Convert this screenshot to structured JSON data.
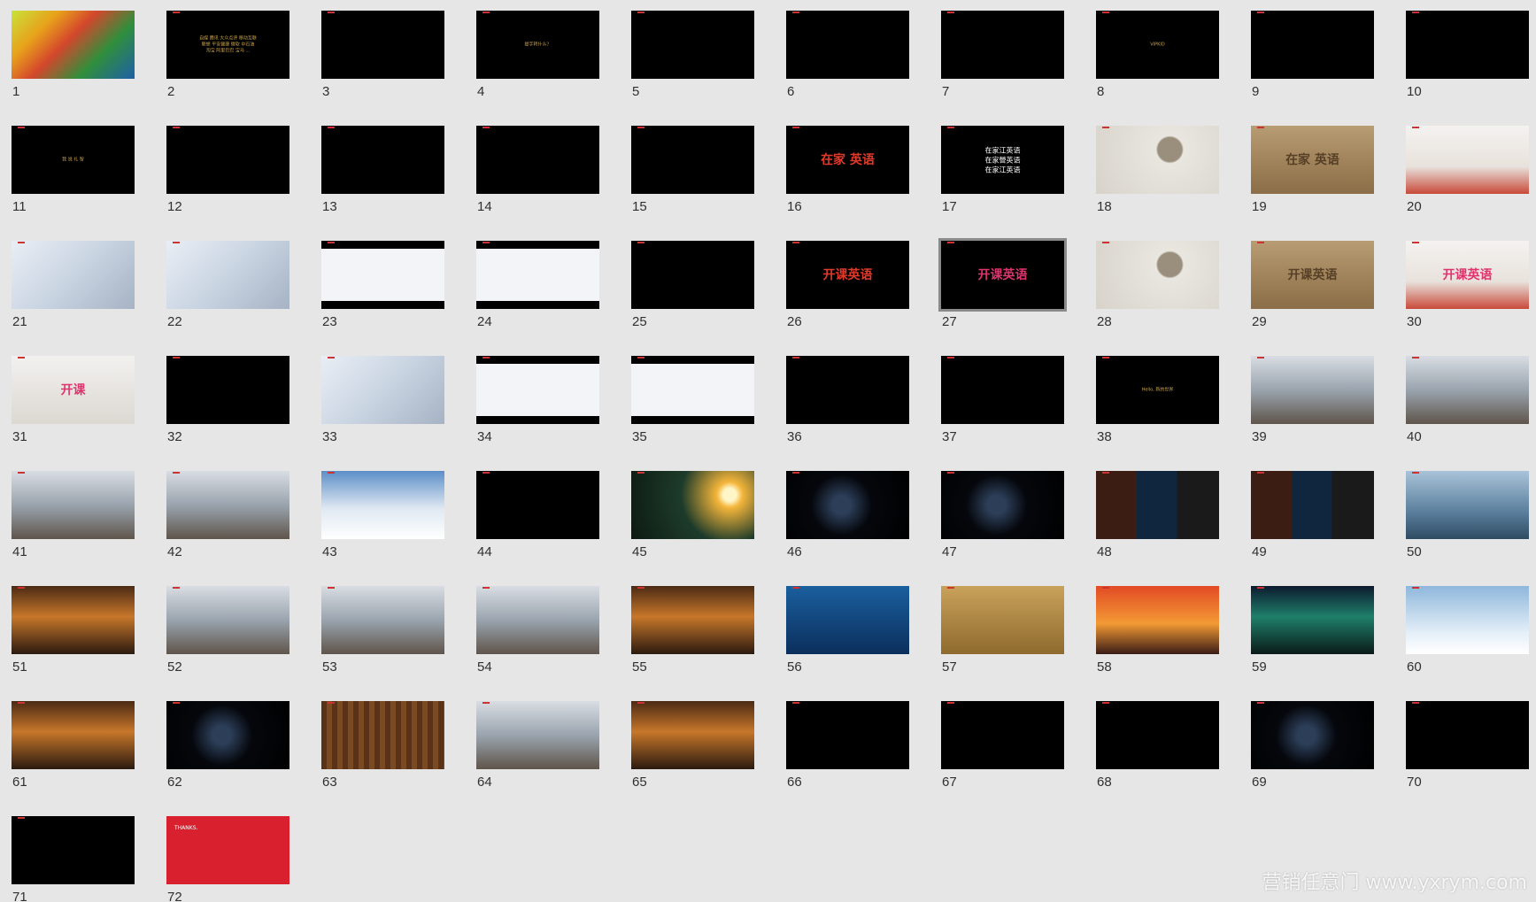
{
  "watermark": "营销任意门 www.yxrym.com",
  "selected_slide": "27",
  "slides": [
    {
      "num": "1",
      "kind": "colorful",
      "cap": ""
    },
    {
      "num": "2",
      "kind": "dark",
      "cap": "自媒  腾讯  大众点评  移动互联\n联想  平安健康  微软  中石油\n淘宝  阿里巴巴  宝马  ..."
    },
    {
      "num": "3",
      "kind": "dark",
      "cap": ""
    },
    {
      "num": "4",
      "kind": "dark",
      "cap": "  提字转什么？"
    },
    {
      "num": "5",
      "kind": "dark",
      "cap": ""
    },
    {
      "num": "6",
      "kind": "dark",
      "cap": ""
    },
    {
      "num": "7",
      "kind": "dark",
      "cap": ""
    },
    {
      "num": "8",
      "kind": "dark",
      "cap": "VIPKID"
    },
    {
      "num": "9",
      "kind": "dark",
      "cap": ""
    },
    {
      "num": "10",
      "kind": "dark",
      "cap": ""
    },
    {
      "num": "11",
      "kind": "dark",
      "cap": "我 说 礼 智"
    },
    {
      "num": "12",
      "kind": "dark",
      "cap": ""
    },
    {
      "num": "13",
      "kind": "dark",
      "cap": ""
    },
    {
      "num": "14",
      "kind": "dark",
      "cap": ""
    },
    {
      "num": "15",
      "kind": "dark",
      "cap": ""
    },
    {
      "num": "16",
      "kind": "dark",
      "cap": "在家 英语",
      "style": "big-red"
    },
    {
      "num": "17",
      "kind": "dark",
      "cap": "在家江英语\n在家營英语\n在家江英语",
      "style": "stack"
    },
    {
      "num": "18",
      "kind": "paper",
      "cap": ""
    },
    {
      "num": "19",
      "kind": "wood",
      "cap": "在家  英语",
      "style": "engrave"
    },
    {
      "num": "20",
      "kind": "office",
      "cap": ""
    },
    {
      "num": "21",
      "kind": "mock",
      "cap": ""
    },
    {
      "num": "22",
      "kind": "mock",
      "cap": ""
    },
    {
      "num": "23",
      "kind": "web",
      "cap": ""
    },
    {
      "num": "24",
      "kind": "web",
      "cap": ""
    },
    {
      "num": "25",
      "kind": "dark",
      "cap": ""
    },
    {
      "num": "26",
      "kind": "dark",
      "cap": "开课英语",
      "style": "big-red"
    },
    {
      "num": "27",
      "kind": "dark",
      "cap": "开课英语",
      "style": "big-pink"
    },
    {
      "num": "28",
      "kind": "paper",
      "cap": ""
    },
    {
      "num": "29",
      "kind": "wood",
      "cap": "开课英语",
      "style": "engrave"
    },
    {
      "num": "30",
      "kind": "office",
      "cap": "开课英语",
      "style": "big-pink"
    },
    {
      "num": "31",
      "kind": "wall",
      "cap": "开课",
      "style": "big-pink"
    },
    {
      "num": "32",
      "kind": "dark",
      "cap": ""
    },
    {
      "num": "33",
      "kind": "mock",
      "cap": ""
    },
    {
      "num": "34",
      "kind": "web",
      "cap": ""
    },
    {
      "num": "35",
      "kind": "web",
      "cap": ""
    },
    {
      "num": "36",
      "kind": "dark",
      "cap": ""
    },
    {
      "num": "37",
      "kind": "dark",
      "cap": ""
    },
    {
      "num": "38",
      "kind": "dark",
      "cap": "Hello, 新的世界"
    },
    {
      "num": "39",
      "kind": "photo",
      "cap": ""
    },
    {
      "num": "40",
      "kind": "photo",
      "cap": ""
    },
    {
      "num": "41",
      "kind": "photo",
      "cap": ""
    },
    {
      "num": "42",
      "kind": "photo",
      "cap": ""
    },
    {
      "num": "43",
      "kind": "snow",
      "cap": ""
    },
    {
      "num": "44",
      "kind": "dark",
      "cap": ""
    },
    {
      "num": "45",
      "kind": "globe",
      "cap": ""
    },
    {
      "num": "46",
      "kind": "space",
      "cap": ""
    },
    {
      "num": "47",
      "kind": "space",
      "cap": ""
    },
    {
      "num": "48",
      "kind": "film",
      "cap": ""
    },
    {
      "num": "49",
      "kind": "film",
      "cap": ""
    },
    {
      "num": "50",
      "kind": "sea",
      "cap": ""
    },
    {
      "num": "51",
      "kind": "sunset",
      "cap": ""
    },
    {
      "num": "52",
      "kind": "photo",
      "cap": ""
    },
    {
      "num": "53",
      "kind": "photo",
      "cap": ""
    },
    {
      "num": "54",
      "kind": "photo",
      "cap": ""
    },
    {
      "num": "55",
      "kind": "sunset",
      "cap": ""
    },
    {
      "num": "56",
      "kind": "ocean",
      "cap": ""
    },
    {
      "num": "57",
      "kind": "sand",
      "cap": ""
    },
    {
      "num": "58",
      "kind": "redsky",
      "cap": ""
    },
    {
      "num": "59",
      "kind": "aurora",
      "cap": ""
    },
    {
      "num": "60",
      "kind": "ice",
      "cap": ""
    },
    {
      "num": "61",
      "kind": "sunset",
      "cap": ""
    },
    {
      "num": "62",
      "kind": "space",
      "cap": ""
    },
    {
      "num": "63",
      "kind": "library",
      "cap": ""
    },
    {
      "num": "64",
      "kind": "photo",
      "cap": ""
    },
    {
      "num": "65",
      "kind": "sunset",
      "cap": ""
    },
    {
      "num": "66",
      "kind": "dark",
      "cap": ""
    },
    {
      "num": "67",
      "kind": "dark",
      "cap": ""
    },
    {
      "num": "68",
      "kind": "dark",
      "cap": ""
    },
    {
      "num": "69",
      "kind": "space",
      "cap": ""
    },
    {
      "num": "70",
      "kind": "dark",
      "cap": ""
    },
    {
      "num": "71",
      "kind": "dark",
      "cap": ""
    },
    {
      "num": "72",
      "kind": "red",
      "cap": "THANKS.",
      "style": "thanks"
    }
  ],
  "colors": {
    "background": "#e6e6e6",
    "slide_dark": "#000000",
    "gold_text": "#c9a24a",
    "brand_red": "#e03a2a",
    "brand_pink": "#e0336e",
    "thanks_red": "#d9202f"
  }
}
